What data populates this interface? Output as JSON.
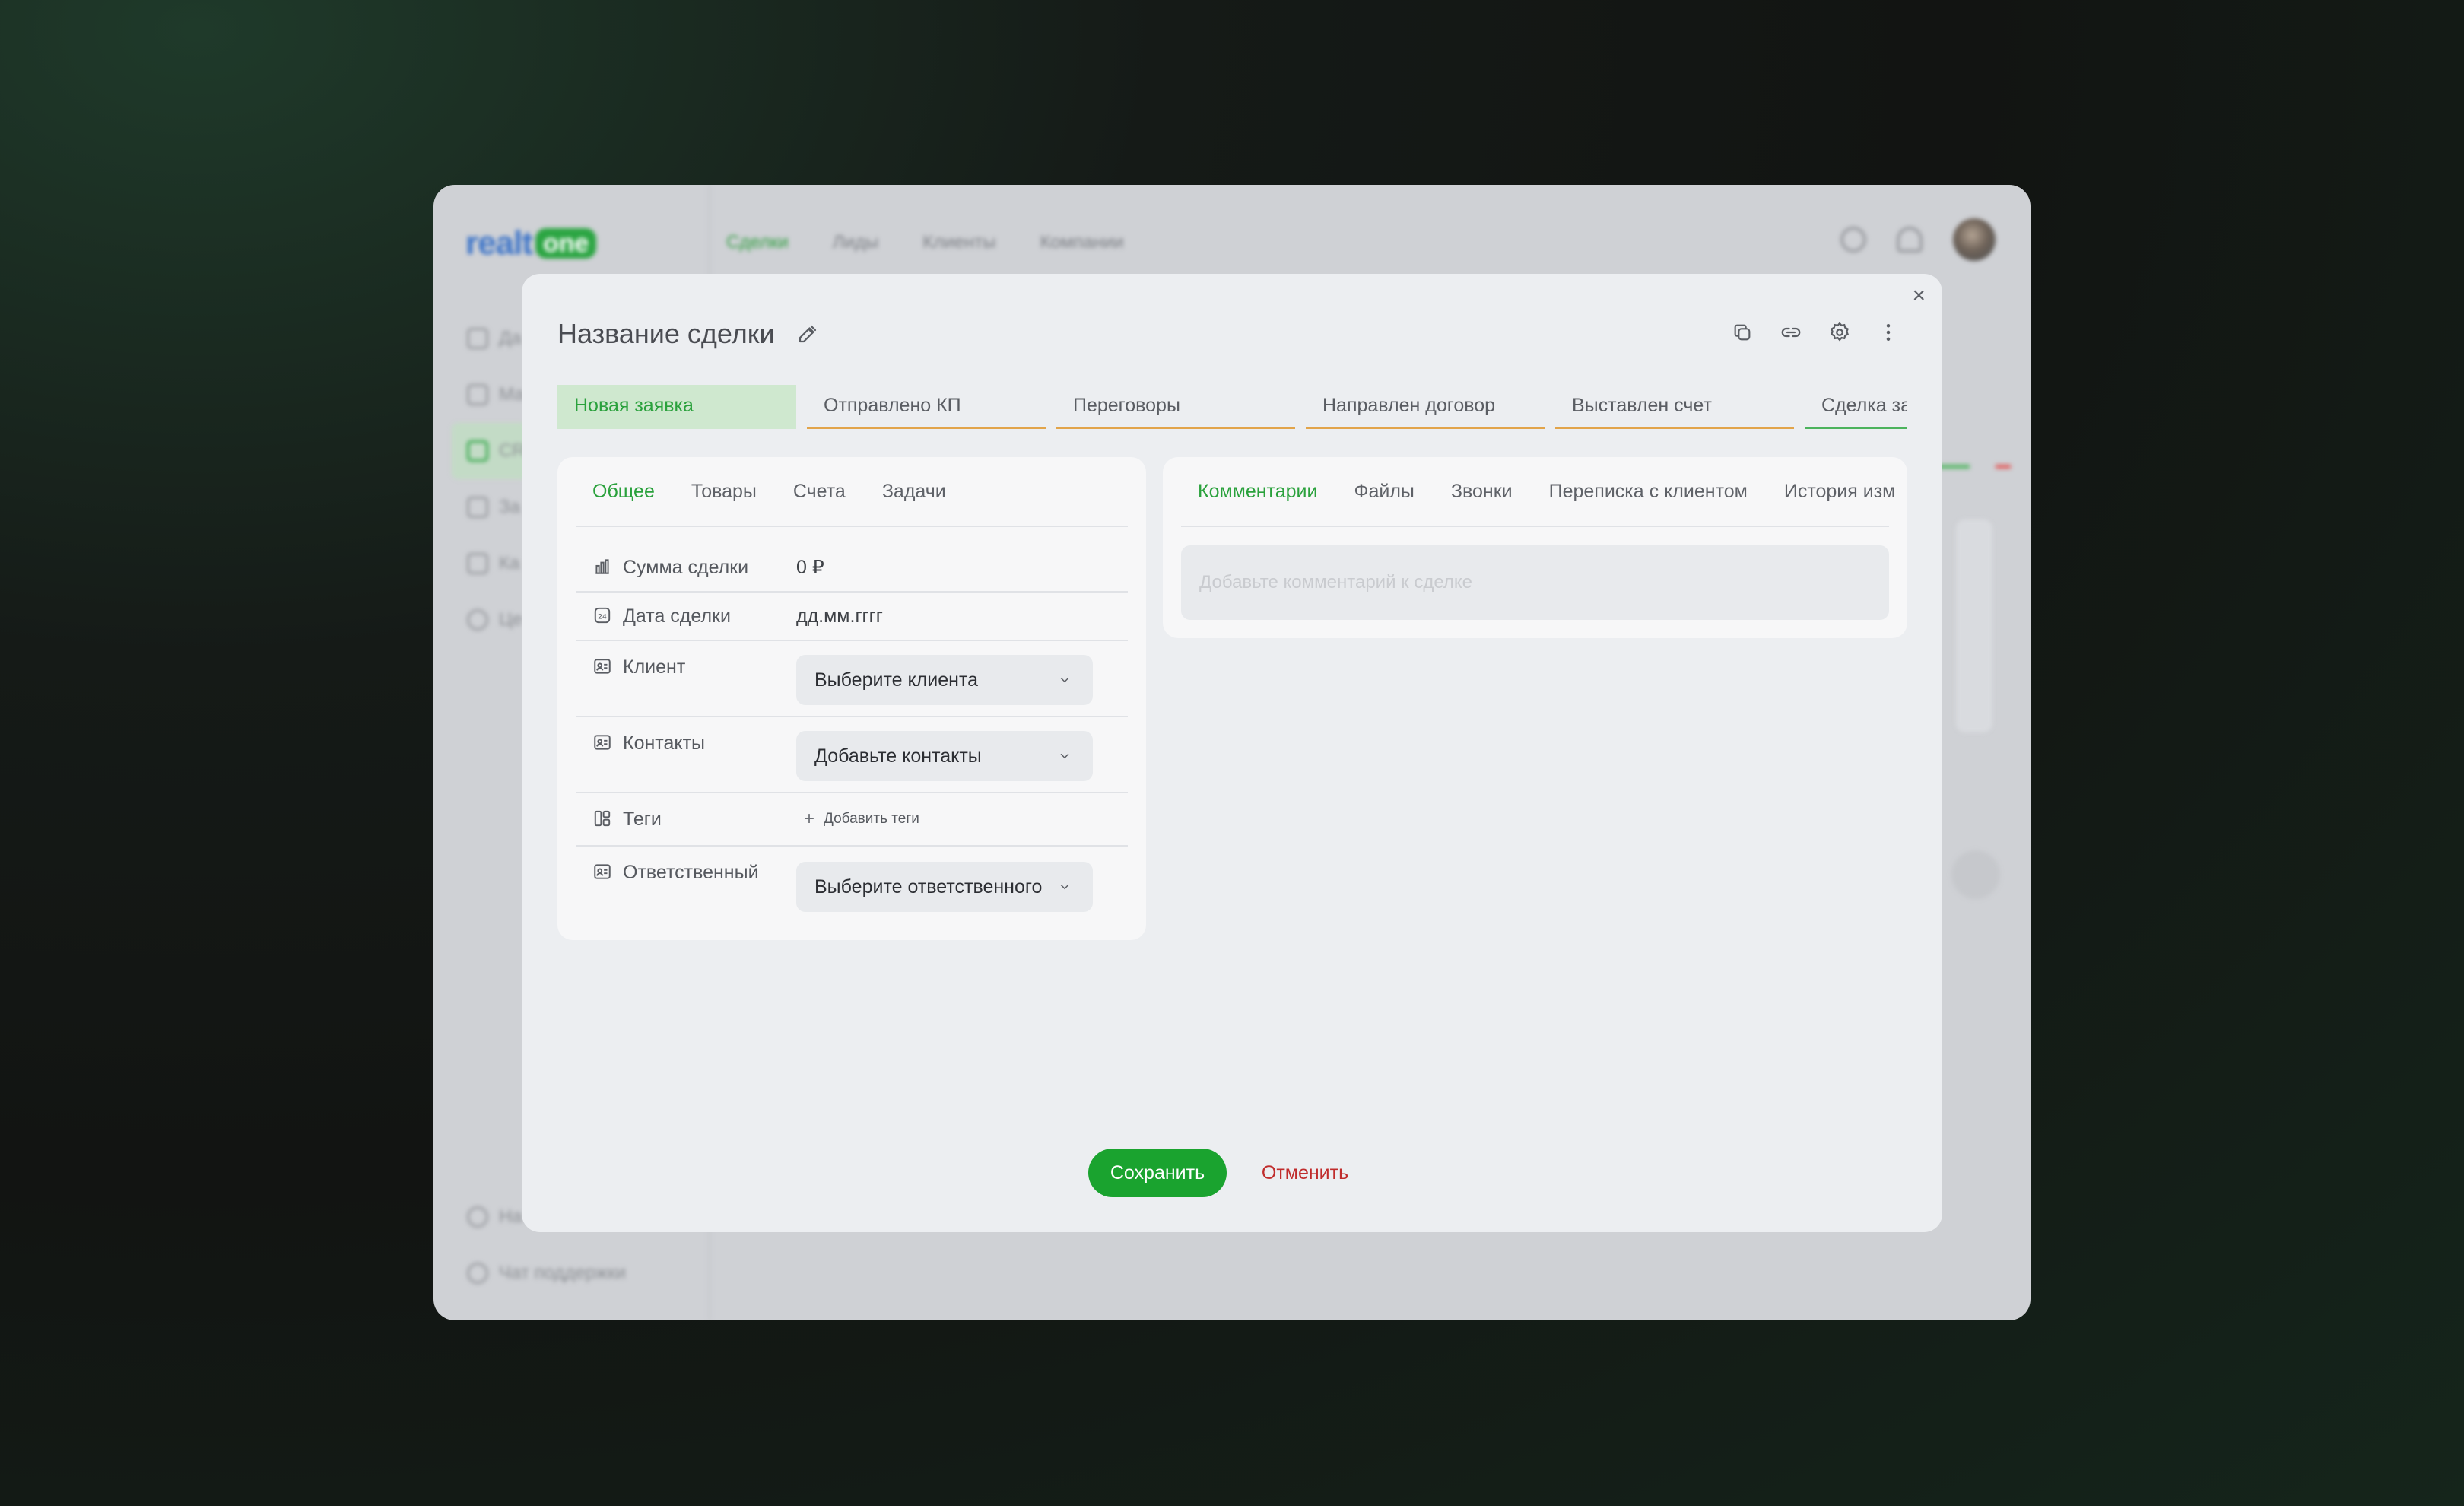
{
  "background_app": {
    "logo": {
      "text_realt": "realt",
      "text_one": "one"
    },
    "nav": [
      "Сделки",
      "Лиды",
      "Клиенты",
      "Компании"
    ],
    "sidebar_items": [
      "Да",
      "Ма",
      "CR",
      "За",
      "Ка",
      "Це"
    ],
    "sidebar_bottom": [
      "На",
      "Чат поддержки"
    ]
  },
  "modal": {
    "title": "Название сделки",
    "close_label": "×",
    "header_tools": [
      "copy-icon",
      "link-icon",
      "gear-icon",
      "more-vertical-icon"
    ],
    "stages": [
      {
        "label": "Новая заявка",
        "active": true
      },
      {
        "label": "Отправлено КП"
      },
      {
        "label": "Переговоры"
      },
      {
        "label": "Направлен договор"
      },
      {
        "label": "Выставлен счет"
      },
      {
        "label": "Сделка зак"
      }
    ],
    "left_tabs": [
      "Общее",
      "Товары",
      "Счета",
      "Задачи"
    ],
    "left_active_tab": "Общее",
    "fields": {
      "amount": {
        "label": "Сумма сделки",
        "value": "0 ₽"
      },
      "date": {
        "label": "Дата сделки",
        "value": "дд.мм.гггг"
      },
      "client": {
        "label": "Клиент",
        "value": "Выберите клиента"
      },
      "contacts": {
        "label": "Контакты",
        "value": "Добавьте контакты"
      },
      "tags": {
        "label": "Теги",
        "action": "Добавить теги"
      },
      "responsible": {
        "label": "Ответственный",
        "value": "Выберите ответственного"
      }
    },
    "right_tabs": [
      "Комментарии",
      "Файлы",
      "Звонки",
      "Переписка с клиентом",
      "История изм"
    ],
    "comment_placeholder": "Добавьте комментарий к сделке",
    "save_label": "Сохранить",
    "cancel_label": "Отменить"
  },
  "colors": {
    "accent": "#1aa32f",
    "stage_active_bg": "#cfe8cf",
    "stage_border": "#e2a44a",
    "danger": "#c02c2c"
  }
}
